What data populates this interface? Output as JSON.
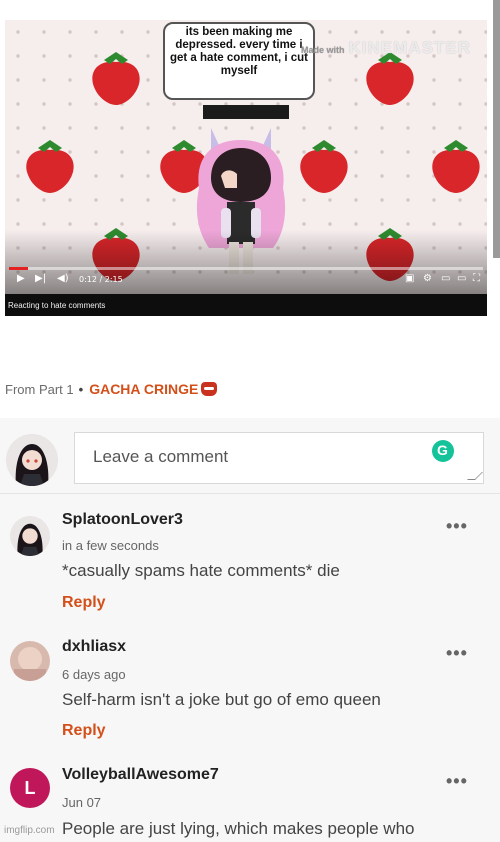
{
  "video": {
    "speech_text": "its been making me depressed. every time i get a hate comment, i cut myself",
    "watermark": "KINEMASTER",
    "watermark_prefix": "Made with",
    "time_display": "0:12 / 2:15",
    "progress": 0.04,
    "caption": "Reacting to hate comments"
  },
  "post_meta": {
    "from_label": "From Part 1",
    "separator": "•",
    "stream_name": "GACHA CRINGE"
  },
  "composer": {
    "placeholder": "Leave a comment"
  },
  "comments": [
    {
      "username": "SplatoonLover3",
      "time": "in a few seconds",
      "text": "*casually spams hate comments* die",
      "reply_label": "Reply",
      "more": "•••"
    },
    {
      "username": "dxhliasx",
      "time": "6 days ago",
      "text": "Self-harm isn't a joke but go of emo queen",
      "reply_label": "Reply",
      "more": "•••"
    },
    {
      "username": "VolleyballAwesome7",
      "avatar_letter": "L",
      "time": "Jun 07",
      "text": "People are just lying, which makes people who",
      "more": "•••"
    }
  ],
  "watermark_footer": "imgflip.com",
  "colors": {
    "accent": "#d4501a",
    "comment_bg": "#f7f7f7",
    "strawberry": "#d8262a",
    "letter_avatar": "#c0175a"
  }
}
